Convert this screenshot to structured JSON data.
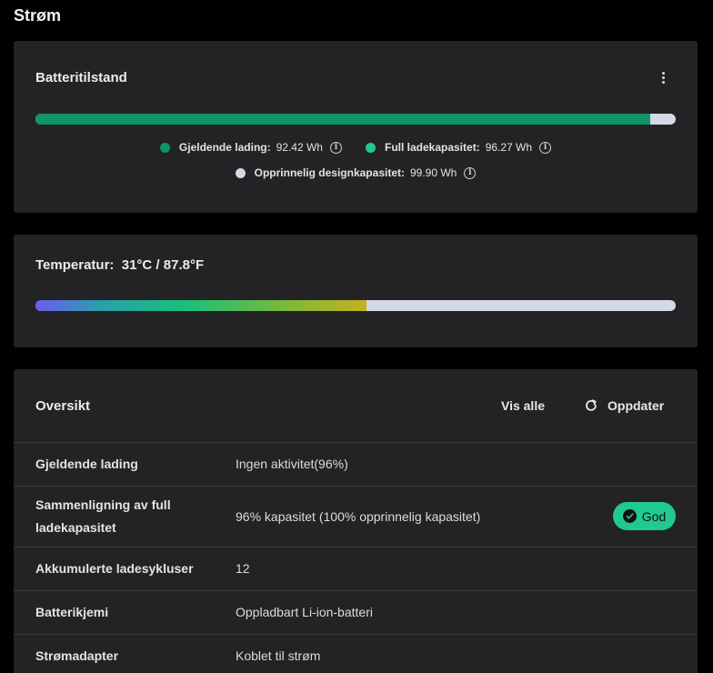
{
  "page": {
    "title": "Strøm"
  },
  "battery": {
    "title": "Batteritilstand",
    "more_icon": "more-vertical-icon",
    "bar": {
      "current_charge_fraction": 0.96
    },
    "legend": [
      {
        "label": "Gjeldende lading:",
        "value": "92.42 Wh",
        "color": "#0f9566"
      },
      {
        "label": "Full ladekapasitet:",
        "value": "96.27 Wh",
        "color": "#21c98f"
      },
      {
        "label": "Opprinnelig designkapasitet:",
        "value": "99.90 Wh",
        "color": "#d4d9e6"
      }
    ],
    "info_icon": "info-icon"
  },
  "temperature": {
    "label": "Temperatur:",
    "value": "31°C / 87.8°F",
    "bar": {
      "level_fraction": 0.517
    }
  },
  "overview": {
    "title": "Oversikt",
    "view_all_label": "Vis alle",
    "refresh_label": "Oppdater",
    "refresh_icon": "refresh-icon",
    "rows": [
      {
        "key": "Gjeldende lading",
        "value": "Ingen aktivitet(96%)"
      },
      {
        "key": "Sammenligning av full ladekapasitet",
        "value": "96% kapasitet (100% opprinnelig kapasitet)",
        "badge": "God"
      },
      {
        "key": "Akkumulerte ladesykluser",
        "value": "12"
      },
      {
        "key": "Batterikjemi",
        "value": "Oppladbart Li-ion-batteri"
      },
      {
        "key": "Strømadapter",
        "value": "Koblet til strøm"
      }
    ]
  }
}
